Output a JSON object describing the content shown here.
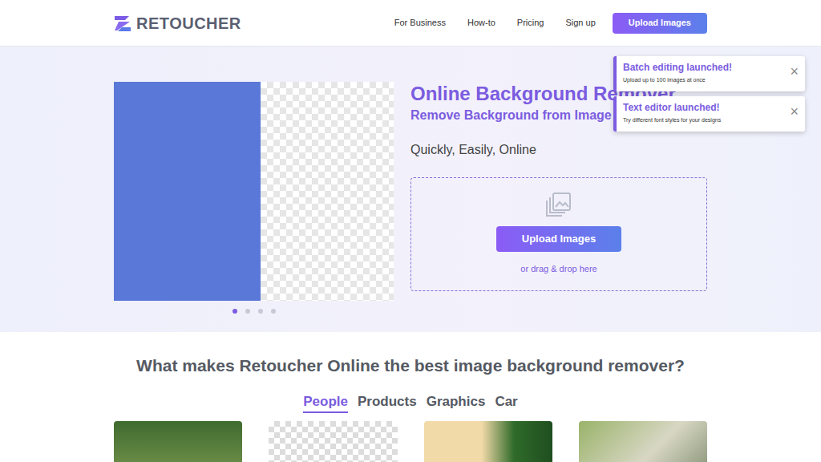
{
  "header": {
    "logo": "RETOUCHER",
    "nav": [
      "For Business",
      "How-to",
      "Pricing",
      "Sign up"
    ],
    "cta": "Upload Images"
  },
  "hero": {
    "title": "Online Background Remover",
    "subtitle": "Remove Background from Image fo",
    "tagline": "Quickly, Easily, Online",
    "upload_button": "Upload Images",
    "drop_hint": "or drag & drop here",
    "carousel_dots": [
      {
        "selected": true
      },
      {
        "selected": false
      },
      {
        "selected": false
      },
      {
        "selected": false
      }
    ]
  },
  "notifications": [
    {
      "title": "Batch editing launched!",
      "text": "Upload up to 100 images at once",
      "close": "×"
    },
    {
      "title": "Text editor launched!",
      "text": "Try different font styles for your designs",
      "close": "×"
    }
  ],
  "features": {
    "heading": "What makes Retoucher Online the best image background remover?",
    "tabs": [
      {
        "label": "People",
        "selected": true
      },
      {
        "label": "Products",
        "selected": false
      },
      {
        "label": "Graphics",
        "selected": false
      },
      {
        "label": "Car",
        "selected": false
      }
    ]
  }
}
